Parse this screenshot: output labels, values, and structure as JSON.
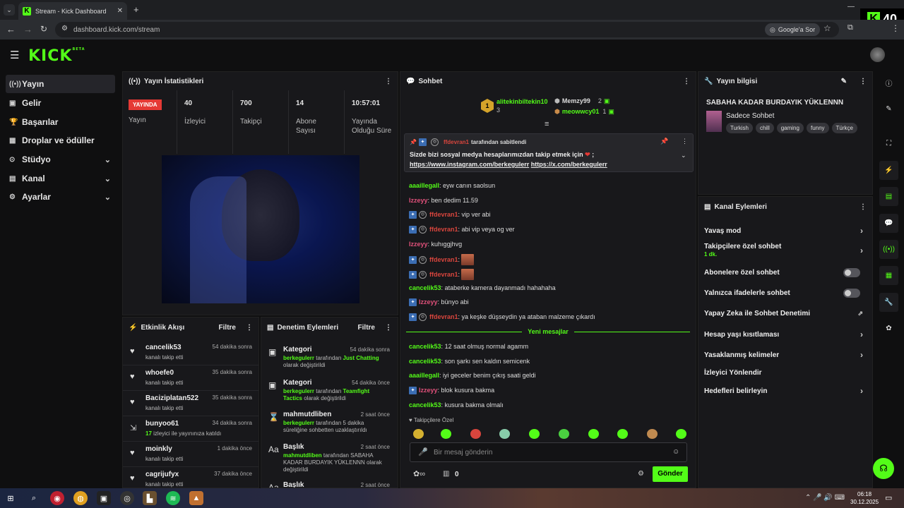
{
  "browser": {
    "tab_title": "Stream - Kick Dashboard",
    "url": "dashboard.kick.com/stream",
    "google_chip": "Google'a Sor",
    "overlay_count": "40"
  },
  "app": {
    "brand": "KICK",
    "brand_sup": "BETA"
  },
  "sidebar": {
    "items": [
      {
        "label": "Yayın",
        "icon": "broadcast-icon"
      },
      {
        "label": "Gelir",
        "icon": "revenue-icon"
      },
      {
        "label": "Başarılar",
        "icon": "trophy-icon"
      },
      {
        "label": "Droplar ve ödüller",
        "icon": "gift-icon"
      },
      {
        "label": "Stüdyo",
        "icon": "studio-icon"
      },
      {
        "label": "Kanal",
        "icon": "channel-icon"
      },
      {
        "label": "Ayarlar",
        "icon": "gear-icon"
      }
    ]
  },
  "stats": {
    "title": "Yayın İstatistikleri",
    "live": "YAYINDA",
    "status_label": "Yayın",
    "viewers": {
      "value": "40",
      "label": "İzleyici"
    },
    "followers": {
      "value": "700",
      "label": "Takipçi"
    },
    "subs": {
      "value": "14",
      "label": "Abone Sayısı"
    },
    "uptime": {
      "value": "10:57:01",
      "label": "Yayında Olduğu Süre"
    }
  },
  "activity": {
    "title": "Etkinlik Akışı",
    "filter": "Filtre",
    "items": [
      {
        "name": "cancelik53",
        "time": "54 dakika sonra",
        "desc": "kanalı takip etti"
      },
      {
        "name": "whoefe0",
        "time": "35 dakika sonra",
        "desc": "kanalı takip etti"
      },
      {
        "name": "Baciziplatan522",
        "time": "35 dakika sonra",
        "desc": "kanalı takip etti"
      },
      {
        "name": "bunyoo61",
        "time": "34 dakika sonra",
        "desc_num": "17",
        "desc": "izleyici ile yayınınıza katıldı"
      },
      {
        "name": "moinkly",
        "time": "1 dakika önce",
        "desc": "kanalı takip etti"
      },
      {
        "name": "cagrijufyx",
        "time": "37 dakika önce",
        "desc": "kanalı takip etti"
      }
    ]
  },
  "modactions": {
    "title": "Denetim Eylemleri",
    "filter": "Filtre",
    "items": [
      {
        "name": "Kategori",
        "time": "54 dakika sonra",
        "user": "berkegulerr",
        "mid": "tarafından",
        "hl": "Just Chatting",
        "rest": "olarak değiştirildi"
      },
      {
        "name": "Kategori",
        "time": "54 dakika önce",
        "user": "berkegulerr",
        "mid": "tarafından",
        "hl": "Teamfight Tactics",
        "rest": "olarak değiştirildi"
      },
      {
        "name": "mahmutdliben",
        "time": "2 saat önce",
        "user": "berkegulerr",
        "mid": "tarafından 5 dakika süreliğine sohbetten uzaklaştırıldı",
        "hl": "",
        "rest": ""
      },
      {
        "name": "Başlık",
        "time": "2 saat önce",
        "user": "mahmutdliben",
        "mid": "tarafından SABAHA KADAR BURDAYIK YÜKLENNN",
        "hl": "",
        "rest": "olarak değiştirildi"
      },
      {
        "name": "Başlık",
        "time": "2 saat önce",
        "user": "",
        "mid": "",
        "hl": "",
        "rest": ""
      }
    ]
  },
  "chat": {
    "title": "Sohbet",
    "top": [
      {
        "name": "alitekinbiltekin10",
        "count": "3"
      },
      {
        "name": "Memzy99",
        "count": "2"
      },
      {
        "name": "meowwcy01",
        "count": "1"
      }
    ],
    "pinned": {
      "user": "ffdevran1",
      "by": "tarafından sabitlendi",
      "text": "Sizde bizi sosyal medya hesaplarımızdan takip etmek için",
      "heart": "❤",
      "tail": ";",
      "link1": "https://www.instagram.com/berkegulerr",
      "link2": "https://x.com/berkegulerr"
    },
    "messages": [
      {
        "user": "aaaillegall",
        "color": "green",
        "text": "eyw canın saolsun"
      },
      {
        "user": "Izzeyy",
        "color": "pink",
        "text": "ben dedim 11.59"
      },
      {
        "user": "ffdevran1",
        "color": "red",
        "text": "vip ver abi"
      },
      {
        "user": "ffdevran1",
        "color": "red",
        "text": "abi vip veya og ver"
      },
      {
        "user": "Izzeyy",
        "color": "pink",
        "text": "kuhıggjhvg"
      },
      {
        "user": "ffdevran1",
        "color": "red",
        "text": ""
      },
      {
        "user": "ffdevran1",
        "color": "red",
        "text": ""
      },
      {
        "user": "cancelik53",
        "color": "green",
        "text": "ataberke kamera dayanmadı hahahaha"
      },
      {
        "user": "Izzeyy",
        "color": "pink",
        "text": "bünyo abi"
      },
      {
        "user": "ffdevran1",
        "color": "red",
        "text": "ya keşke düşseydin ya ataban malzeme çıkardı"
      }
    ],
    "new_divider": "Yeni mesajlar",
    "new_messages": [
      {
        "user": "cancelik53",
        "color": "green",
        "text": "12 saat olmuş normal agamm"
      },
      {
        "user": "cancelik53",
        "color": "green",
        "text": "son şarkı sen kaldın semicenk"
      },
      {
        "user": "aaaillegall",
        "color": "green",
        "text": "iyi geceler benim çıkış saati geldi"
      },
      {
        "user": "Izzeyy",
        "color": "pink",
        "text": "blok kusura bakma"
      },
      {
        "user": "cancelik53",
        "color": "green",
        "text": "kusura bakma olmalı"
      }
    ],
    "follower_only": "Takipçilere Özel",
    "input_placeholder": "Bir mesaj gönderin",
    "gift_count": "0",
    "send": "Gönder"
  },
  "info": {
    "title": "Yayın bilgisi",
    "stream_title": "SABAHA KADAR BURDAYIK YÜKLENNN",
    "category": "Sadece Sohbet",
    "tags": [
      "Turkish",
      "chill",
      "gaming",
      "funny",
      "Türkçe"
    ]
  },
  "channel_actions": {
    "title": "Kanal Eylemleri",
    "items": [
      {
        "label": "Yavaş mod",
        "type": "arrow"
      },
      {
        "label": "Takipçilere özel sohbet",
        "sub": "1 dk.",
        "type": "arrow"
      },
      {
        "label": "Abonelere özel sohbet",
        "type": "toggle"
      },
      {
        "label": "Yalnızca ifadelerle sohbet",
        "type": "toggle"
      },
      {
        "label": "Yapay Zeka ile Sohbet Denetimi",
        "type": "external"
      },
      {
        "label": "Hesap yaşı kısıtlaması",
        "type": "arrow"
      },
      {
        "label": "Yasaklanmış kelimeler",
        "type": "arrow"
      },
      {
        "label": "İzleyici Yönlendir",
        "type": "none"
      },
      {
        "label": "Hedefleri belirleyin",
        "type": "arrow"
      }
    ]
  },
  "taskbar": {
    "time": "06:18",
    "date": "30.12.2025"
  },
  "colors": {
    "accent": "#53fc18",
    "live": "#e53935",
    "bg": "#0f0f10",
    "panel": "#18181b"
  }
}
